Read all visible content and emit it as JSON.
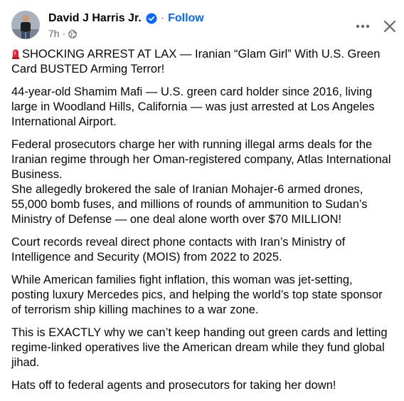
{
  "header": {
    "author": "David J Harris Jr.",
    "separator": "·",
    "follow_label": "Follow",
    "time": "7h ·",
    "icons": [
      "verified-badge-icon",
      "globe-icon",
      "more-options-icon",
      "close-icon"
    ],
    "colors": {
      "follow": "#0866ff",
      "meta": "#65676b",
      "verified": "#0866ff"
    }
  },
  "post": {
    "headline": "SHOCKING ARREST AT LAX — Iranian “Glam Girl” With U.S. Green Card BUSTED Arming Terror!",
    "headline_icon": "siren-emoji",
    "paragraphs": [
      "44-year-old Shamim Mafi — U.S. green card holder since 2016, living large in Woodland Hills, California — was just arrested at Los Angeles International Airport.",
      "Federal prosecutors charge her with running illegal arms deals for the Iranian regime through her Oman-registered company, Atlas International Business.\nShe allegedly brokered the sale of Iranian Mohajer-6 armed drones, 55,000 bomb fuses, and millions of rounds of ammunition to Sudan’s Ministry of Defense — one deal alone worth over $70 MILLION!",
      "Court records reveal direct phone contacts with Iran’s Ministry of Intelligence and Security (MOIS) from 2022 to 2025.",
      "While American families fight inflation, this woman was jet-setting, posting luxury Mercedes pics, and helping the world’s top state sponsor of terrorism ship killing machines to a war zone.",
      "This is EXACTLY why we can’t keep handing out green cards and letting regime-linked operatives live the American dream while they fund global jihad.",
      "Hats off to federal agents and prosecutors for taking her down!"
    ]
  }
}
